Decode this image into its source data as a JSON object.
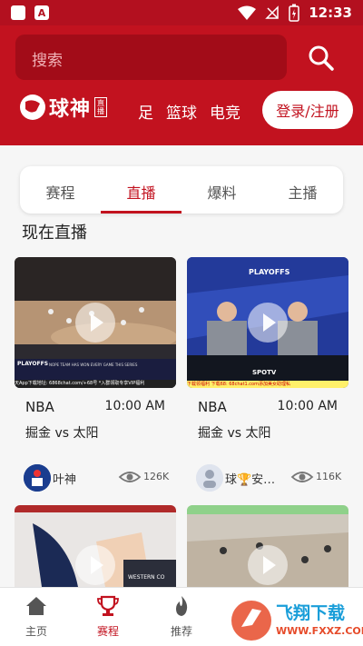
{
  "status_bar": {
    "time": "12:33",
    "left_icons": [
      "notification-badge-icon",
      "text-a-icon"
    ],
    "right_icons": [
      "wifi-icon",
      "signal-off-icon",
      "battery-icon"
    ]
  },
  "header": {
    "search_placeholder": "搜索",
    "logo_text": "球神",
    "logo_tag": "直播",
    "nav": [
      "足",
      "篮球",
      "电竞"
    ],
    "login_label": "登录/注册"
  },
  "tabs": [
    {
      "label": "赛程",
      "active": false
    },
    {
      "label": "直播",
      "active": true
    },
    {
      "label": "爆料",
      "active": false
    },
    {
      "label": "主播",
      "active": false
    }
  ],
  "section_title": "现在直播",
  "cards": [
    {
      "league": "NBA",
      "time": "10:00 AM",
      "match": "掘金 vs 太阳",
      "author": "叶神",
      "views": "126K",
      "thumb_overlay_top": "PLAYOFFS",
      "thumb_overlay_caption": "NOPE TEAM HAS WON EVERY GAME THIS SERIES",
      "thumb_overlay_bottom": "天App下载地址: 6868chat.com/+68号 *入群领取专享VIP福利"
    },
    {
      "league": "NBA",
      "time": "10:00 AM",
      "match": "掘金 vs 太阳",
      "author": "球🏆安…",
      "views": "116K",
      "thumb_overlay_top": "PLAYOFFS",
      "thumb_overlay_badge": "SPOTV",
      "thumb_overlay_bottom": "下载领福利 下载68: 68chat1.com添加美女助理私"
    },
    {
      "thumb_overlay_top": "WESTERN CO"
    },
    {
      "thumb_overlay_top": ""
    }
  ],
  "bottom_nav": [
    {
      "label": "主页",
      "icon": "home-icon",
      "active": false
    },
    {
      "label": "赛程",
      "icon": "trophy-icon",
      "active": true
    },
    {
      "label": "推荐",
      "icon": "flame-icon",
      "active": false
    }
  ],
  "watermark": {
    "text": "飞翔下载",
    "url": "WWW.FXXZ.COM"
  },
  "colors": {
    "brand_red": "#c2121f",
    "status_red": "#b3101f"
  }
}
